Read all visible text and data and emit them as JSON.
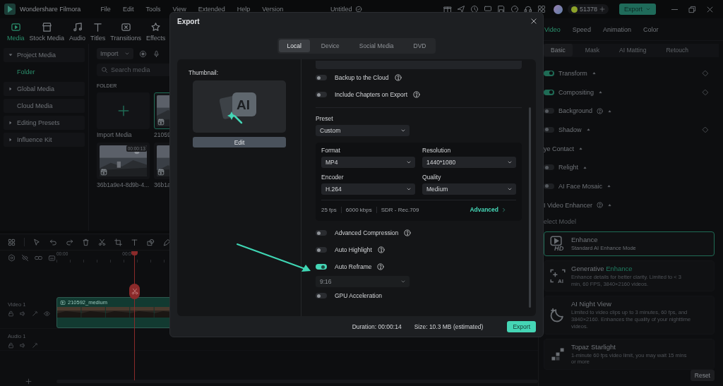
{
  "title_bar": {
    "app_name": "Wondershare Filmora",
    "menu": [
      "File",
      "Edit",
      "Tools",
      "View",
      "Extended",
      "Help",
      "Version"
    ],
    "document_title": "Untitled",
    "credits": "51378",
    "export_button": "Export"
  },
  "media_tabs": [
    {
      "label": "Media",
      "selected": true
    },
    {
      "label": "Stock Media",
      "selected": false
    },
    {
      "label": "Audio",
      "selected": false
    },
    {
      "label": "Titles",
      "selected": false
    },
    {
      "label": "Transitions",
      "selected": false
    },
    {
      "label": "Effects",
      "selected": false
    }
  ],
  "sidebar": {
    "items": [
      {
        "label": "Project Media",
        "selected": false,
        "expanded": true,
        "children": [
          {
            "label": "Folder",
            "selected": true
          }
        ]
      },
      {
        "label": "Global Media",
        "selected": false,
        "expanded": false
      },
      {
        "label": "Cloud Media",
        "selected": false
      },
      {
        "label": "Editing Presets",
        "selected": false,
        "expanded": false
      },
      {
        "label": "Influence Kit",
        "selected": false,
        "expanded": false
      }
    ]
  },
  "media": {
    "import_button": "Import",
    "search": {
      "placeholder": "Search media"
    },
    "section_title": "FOLDER",
    "tiles": [
      {
        "kind": "import",
        "label": "Import Media"
      },
      {
        "kind": "clip",
        "label": "21059",
        "selected": true
      },
      {
        "kind": "clip",
        "label": "36b1a9e4-8d9b-4...",
        "duration": "00:00:13",
        "selected": false
      },
      {
        "kind": "clip",
        "label": "36b1a",
        "selected": false
      }
    ]
  },
  "timeline": {
    "ruler": [
      "00:00",
      "00:0"
    ],
    "tracks": [
      {
        "kind": "video",
        "name": "Video 1",
        "clip": "210592_medium"
      },
      {
        "kind": "audio",
        "name": "Audio 1"
      }
    ]
  },
  "properties": {
    "tabs": [
      {
        "label": "Video",
        "selected": true
      },
      {
        "label": "Speed",
        "selected": false
      },
      {
        "label": "Animation",
        "selected": false
      },
      {
        "label": "Color",
        "selected": false
      }
    ],
    "subtabs": [
      {
        "label": "Basic",
        "selected": true
      },
      {
        "label": "Mask",
        "selected": false
      },
      {
        "label": "AI Matting",
        "selected": false
      },
      {
        "label": "Retouch",
        "selected": false
      }
    ],
    "rows": [
      {
        "kind": "toggle",
        "label": "Transform",
        "on": true,
        "keyframe": true
      },
      {
        "kind": "toggle",
        "label": "Compositing",
        "on": true,
        "keyframe": true
      },
      {
        "kind": "toggle",
        "label": "Background",
        "on": false,
        "help": true
      },
      {
        "kind": "toggle",
        "label": "Shadow",
        "on": false,
        "keyframe": true
      },
      {
        "kind": "plain",
        "label": "ye Contact"
      },
      {
        "kind": "toggle",
        "label": "Relight",
        "on": false
      },
      {
        "kind": "toggle",
        "label": "AI Face Mosaic",
        "on": false
      },
      {
        "kind": "plain",
        "label": "I Video Enhancer",
        "help": true
      },
      {
        "kind": "caption",
        "label": "elect Model"
      }
    ],
    "models": [
      {
        "kind": "hd",
        "icon_text": "HD",
        "title": "Enhance",
        "description": "Standard AI Enhance Mode",
        "selected": true
      },
      {
        "kind": "ai",
        "icon_text": "AI",
        "title": "Generative",
        "title_highlight": "Enhance",
        "description": "Enhance details for better clarity. Limited to < 3 min, 60 FPS, 3840×2160 videos.",
        "selected": false
      },
      {
        "kind": "night",
        "title": "AI Night View",
        "description": "Limited to video clips up to 3 minutes, 60 fps, and 3840×2160. Enhances the quality of your nighttime videos.",
        "selected": false
      },
      {
        "kind": "pixels",
        "title": "Topaz Starlight",
        "description": "1-minute 60 fps video limit, you may wait 15 mins or more",
        "selected": false
      }
    ],
    "reset_button": "Reset"
  },
  "export_dialog": {
    "title": "Export",
    "tabs": [
      {
        "label": "Local",
        "selected": true
      },
      {
        "label": "Device",
        "selected": false
      },
      {
        "label": "Social Media",
        "selected": false
      },
      {
        "label": "DVD",
        "selected": false
      }
    ],
    "thumbnail_label": "Thumbnail:",
    "thumbnail_text": "AI",
    "edit_button": "Edit",
    "options_top": [
      {
        "label": "Backup to the Cloud",
        "on": false,
        "help": true
      },
      {
        "label": "Include Chapters on Export",
        "on": false,
        "help": true
      }
    ],
    "preset": {
      "label": "Preset",
      "value": "Custom"
    },
    "settings": [
      {
        "label": "Format",
        "value": "MP4"
      },
      {
        "label": "Resolution",
        "value": "1440*1080"
      },
      {
        "label": "Encoder",
        "value": "H.264"
      },
      {
        "label": "Quality",
        "value": "Medium"
      }
    ],
    "summary": [
      "25 fps",
      "6000 kbps",
      "SDR - Rec.709"
    ],
    "advanced_link": "Advanced",
    "options": [
      {
        "kind": "toggle",
        "label": "Advanced Compression",
        "on": false,
        "help": true
      },
      {
        "kind": "toggle",
        "label": "Auto Highlight",
        "on": false,
        "help": true
      },
      {
        "kind": "toggle",
        "label": "Auto Reframe",
        "on": true,
        "help": true
      },
      {
        "kind": "select",
        "value": "9:16",
        "disabled": true
      },
      {
        "kind": "toggle",
        "label": "GPU Acceleration",
        "on": false
      }
    ],
    "duration": "Duration: 00:00:14",
    "size": "Size: 10.3 MB (estimated)",
    "export_button": "Export"
  }
}
